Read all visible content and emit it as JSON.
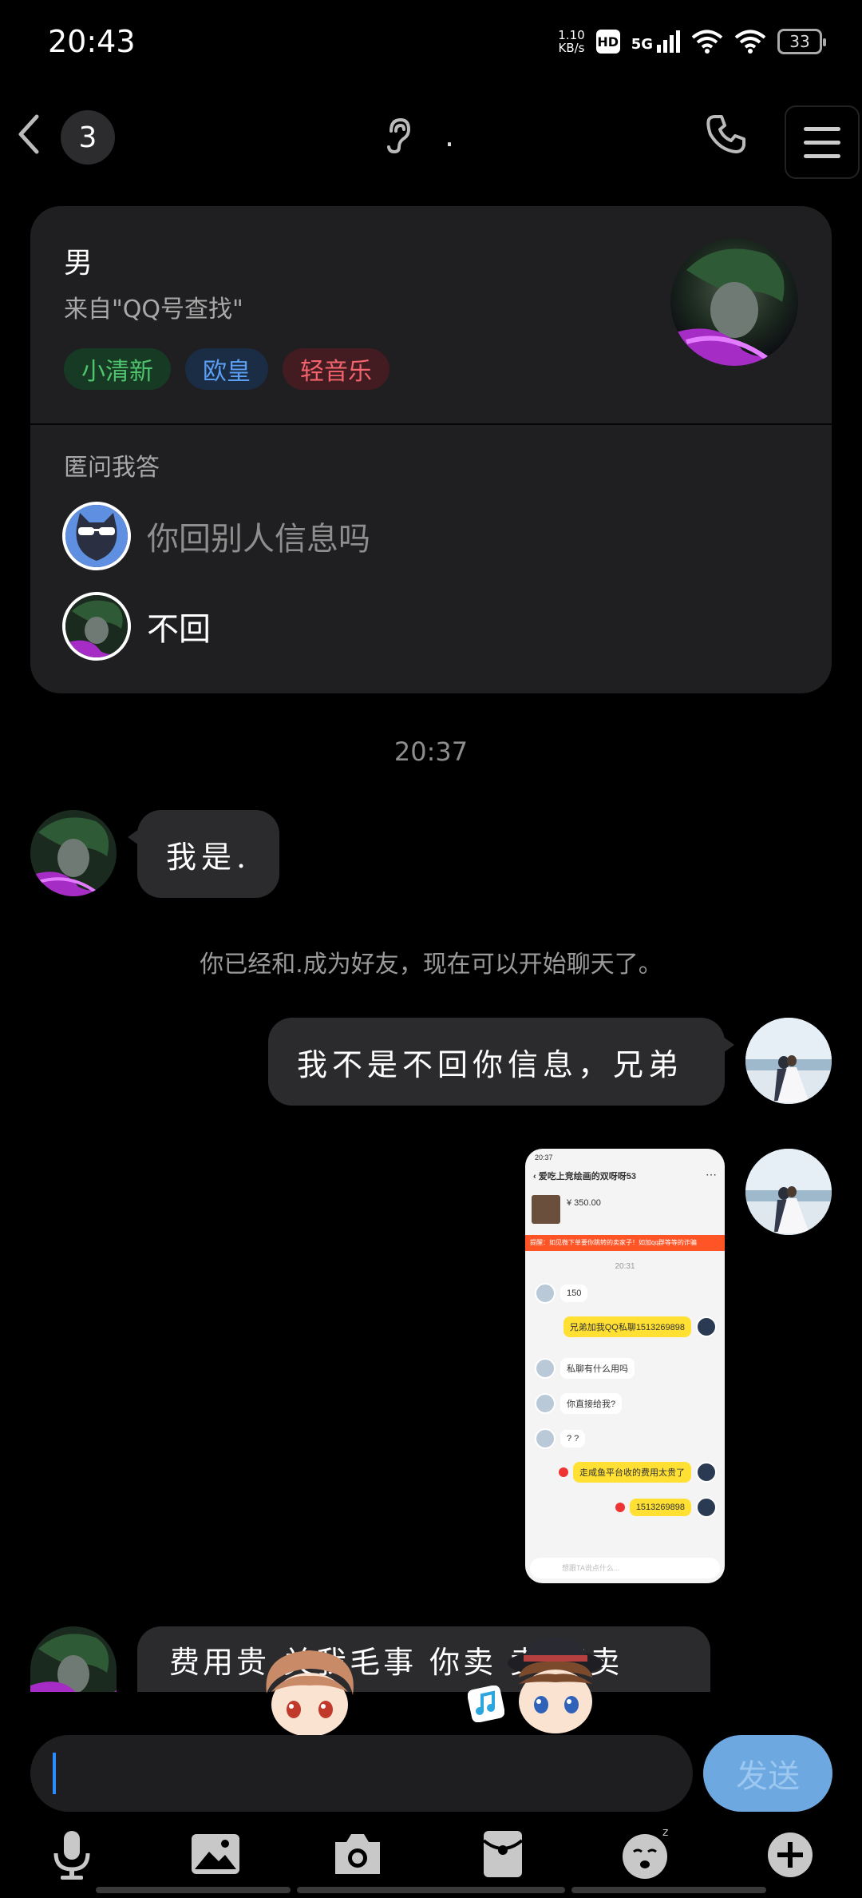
{
  "status_bar": {
    "time": "20:43",
    "net_speed_value": "1.10",
    "net_speed_unit": "KB/s",
    "hd": "HD",
    "signal": "5G",
    "battery": "33"
  },
  "header": {
    "unread_count": "3",
    "title": "."
  },
  "profile_card": {
    "gender": "男",
    "source": "来自\"QQ号查找\"",
    "tags": [
      "小清新",
      "欧皇",
      "轻音乐"
    ],
    "qa_title": "匿问我答",
    "question": "你回别人信息吗",
    "answer": "不回"
  },
  "chat": {
    "timestamp": "20:37",
    "msg_in_1": "我是.",
    "system_msg": "你已经和.成为好友，现在可以开始聊天了。",
    "msg_out_1": "我不是不回你信息，兄弟",
    "msg_in_2": "费用贵 关我毛事 你卖 卖 不卖"
  },
  "screenshot_image": {
    "time": "20:37",
    "title": "爱吃上竞绘画的双呀呀53",
    "price": "¥ 350.00",
    "warning": "提醒：如见微下单要你跳转的卖家子！如加qq群等等的诈骗",
    "inner_time": "20:31",
    "messages": [
      {
        "side": "left",
        "text": "150"
      },
      {
        "side": "right",
        "text": "兄弟加我QQ私聊1513269898"
      },
      {
        "side": "left",
        "text": "私聊有什么用吗"
      },
      {
        "side": "left",
        "text": "你直接给我?"
      },
      {
        "side": "left",
        "text": "? ?"
      },
      {
        "side": "right",
        "text": "走咸鱼平台收的费用太贵了"
      },
      {
        "side": "right",
        "text": "1513269898"
      }
    ],
    "input_placeholder": "想跟TA说点什么..."
  },
  "input": {
    "value": "",
    "send_label": "发送"
  },
  "colors": {
    "background": "#000000",
    "bubble": "#2b2b2d",
    "card": "#1f1f21",
    "send_button": "#6da8e0",
    "caret": "#2b8cff"
  },
  "icons": [
    "back-icon",
    "ear-icon",
    "phone-icon",
    "menu-icon",
    "microphone-icon",
    "image-icon",
    "camera-icon",
    "red-packet-icon",
    "emoji-icon",
    "plus-icon"
  ]
}
